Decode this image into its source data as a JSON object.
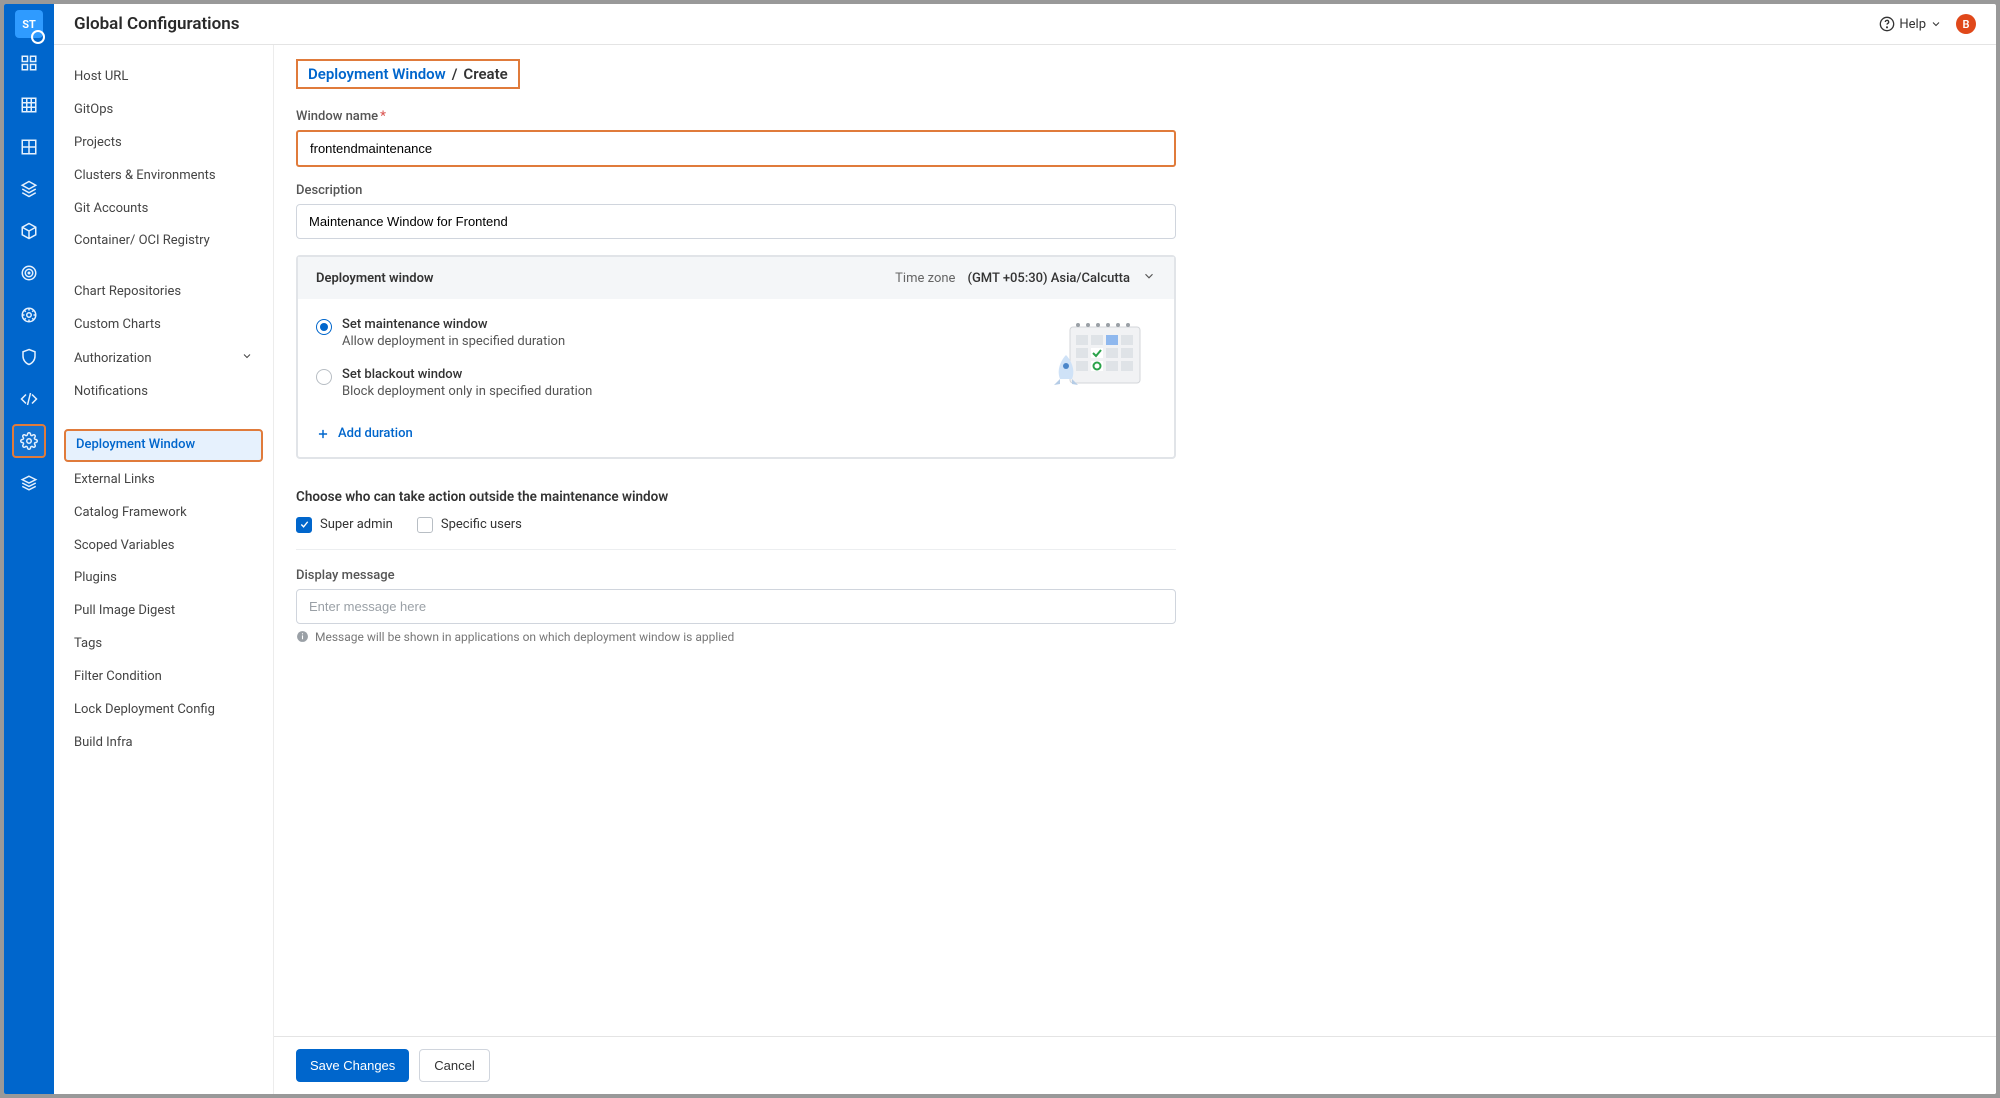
{
  "rail": {
    "logo_text": "ST"
  },
  "header": {
    "title": "Global Configurations",
    "help_label": "Help",
    "avatar_initial": "B"
  },
  "config_nav": {
    "group1": [
      "Host URL",
      "GitOps",
      "Projects",
      "Clusters & Environments",
      "Git Accounts",
      "Container/ OCI Registry"
    ],
    "group2": [
      "Chart Repositories",
      "Custom Charts",
      "Authorization",
      "Notifications"
    ],
    "selected": "Deployment Window",
    "group3": [
      "External Links",
      "Catalog Framework",
      "Scoped Variables",
      "Plugins",
      "Pull Image Digest",
      "Tags",
      "Filter Condition",
      "Lock Deployment Config",
      "Build Infra"
    ]
  },
  "breadcrumb": {
    "link": "Deployment Window",
    "sep": "/",
    "current": "Create"
  },
  "form": {
    "name_label": "Window name",
    "name_value": "frontendmaintenance",
    "desc_label": "Description",
    "desc_value": "Maintenance Window for Frontend",
    "dw_header": "Deployment window",
    "tz_label": "Time zone",
    "tz_value": "(GMT +05:30) Asia/Calcutta",
    "radio_maint_title": "Set maintenance window",
    "radio_maint_sub": "Allow deployment in specified duration",
    "radio_black_title": "Set blackout window",
    "radio_black_sub": "Block deployment only in specified duration",
    "add_duration": "Add duration",
    "who_label": "Choose who can take action outside the maintenance window",
    "check_super": "Super admin",
    "check_specific": "Specific users",
    "display_msg_label": "Display message",
    "display_msg_placeholder": "Enter message here",
    "display_msg_hint": "Message will be shown in applications on which deployment window is applied"
  },
  "footer": {
    "save": "Save Changes",
    "cancel": "Cancel"
  }
}
